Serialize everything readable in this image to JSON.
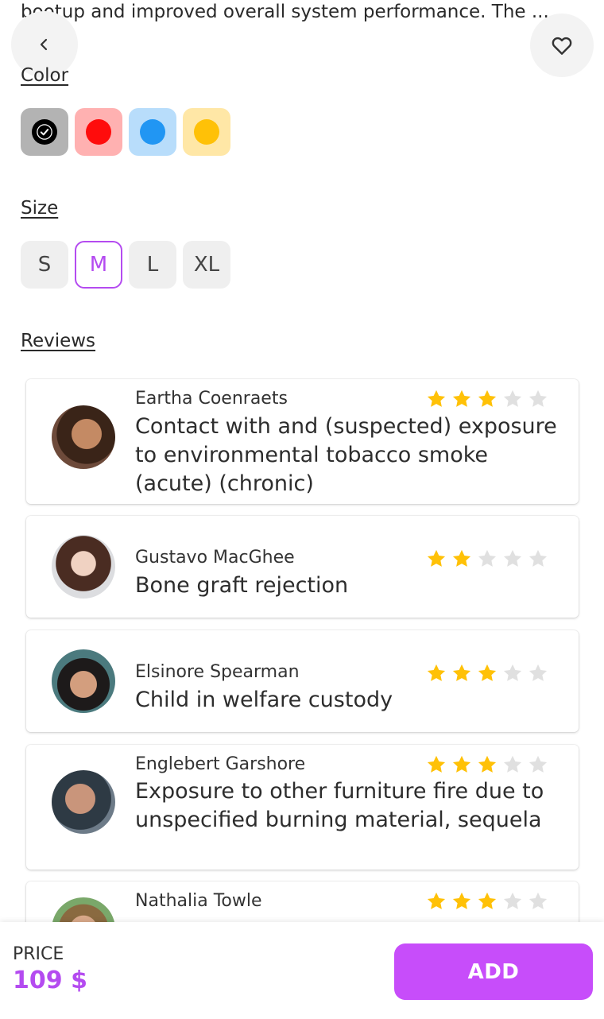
{
  "description_snippet": "bootup and improved overall system performance. The ...",
  "colors_section": {
    "label": "Color",
    "options": [
      {
        "name": "black",
        "swatch_bg": "#b3b3b3",
        "dot": "#000000",
        "selected": true
      },
      {
        "name": "red",
        "swatch_bg": "#ffb1b1",
        "dot": "#ff0c0c",
        "selected": false
      },
      {
        "name": "blue",
        "swatch_bg": "#b8ddfb",
        "dot": "#2196f3",
        "selected": false
      },
      {
        "name": "yellow",
        "swatch_bg": "#ffe7a6",
        "dot": "#ffc107",
        "selected": false
      }
    ]
  },
  "size_section": {
    "label": "Size",
    "options": [
      "S",
      "M",
      "L",
      "XL"
    ],
    "selected": "M"
  },
  "reviews_section": {
    "label": "Reviews",
    "items": [
      {
        "name": "Eartha Coenraets",
        "text": "Contact with and (suspected) exposure to environmental tobacco smoke (acute) (chronic)",
        "rating": 3
      },
      {
        "name": "Gustavo MacGhee",
        "text": "Bone graft rejection",
        "rating": 2
      },
      {
        "name": "Elsinore Spearman",
        "text": "Child in welfare custody",
        "rating": 3
      },
      {
        "name": "Englebert Garshore",
        "text": "Exposure to other furniture fire due to unspecified burning material, sequela",
        "rating": 3
      },
      {
        "name": "Nathalia Towle",
        "text": "",
        "rating": 3
      }
    ]
  },
  "footer": {
    "price_label": "PRICE",
    "price_value": "109 $",
    "add_label": "ADD"
  },
  "theme": {
    "accent": "#c74dfa",
    "star_on": "#ffc107",
    "star_off": "#e0e0e0"
  },
  "icons": {
    "back": "chevron-left-icon",
    "favorite": "heart-outline-icon",
    "check": "check-icon",
    "star": "star-icon"
  }
}
